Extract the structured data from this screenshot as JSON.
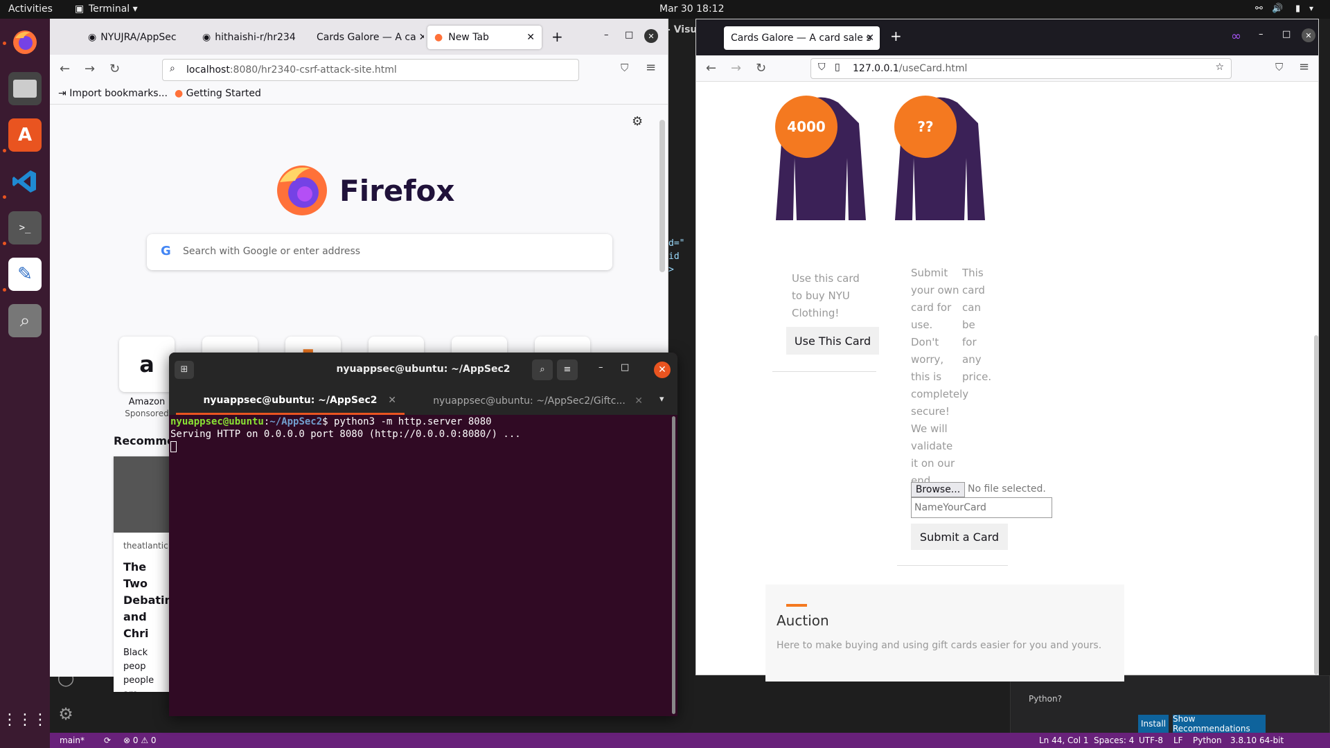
{
  "topbar": {
    "activities": "Activities",
    "app": "Terminal ▾",
    "datetime": "Mar 30  18:12"
  },
  "vscode": {
    "title_fragment": "- Visu",
    "code_fragments": [
      "d=\"",
      " id",
      ">"
    ],
    "status": {
      "branch": "main*",
      "errors": "⊗ 0 ⚠ 0",
      "position": "Ln 44, Col 1",
      "spaces": "Spaces: 4",
      "encoding": "UTF-8",
      "eol": "LF",
      "language": "Python",
      "version": "3.8.10 64-bit"
    },
    "notification": {
      "text": "Python?",
      "install": "Install",
      "recommend": "Show Recommendations"
    }
  },
  "ff_left": {
    "tabs": [
      "NYUJRA/AppSec",
      "hithaishi-r/hr234",
      "Cards Galore — A ca",
      "New Tab"
    ],
    "url_host": "localhost",
    "url_rest": ":8080/hr2340-csrf-attack-site.html",
    "bookmarks": [
      "Import bookmarks...",
      "Getting Started"
    ],
    "brand": "Firefox",
    "search_placeholder": "Search with Google or enter address",
    "tiles": [
      {
        "label": "Amazon",
        "sub": "Sponsored"
      }
    ],
    "recommended": "Recomme",
    "story": {
      "source": "theatlantic",
      "title": "The Two Debatin and Chri",
      "snippet": "Black peop people are discussing"
    }
  },
  "ff_right": {
    "tab": "Cards Galore — A card sale s",
    "url_host": "127.0.0.1",
    "url_rest": "/useCard.html",
    "cards": [
      {
        "badge": "4000"
      },
      {
        "badge": "??"
      }
    ],
    "card1_text": "Use this card to buy NYU Clothing!",
    "card1_button": "Use This Card",
    "card2_text": "Submit your own card for use. Don't worry, this is completely secure! We will validate it on our end.",
    "card2_text_b": "This card can be for any price.",
    "browse": "Browse...",
    "no_file": "No file selected.",
    "name_placeholder": "NameYourCard",
    "submit": "Submit a Card",
    "auction_title": "Auction",
    "auction_text": "Here to make buying and using gift cards easier for you and yours."
  },
  "terminal": {
    "title": "nyuappsec@ubuntu: ~/AppSec2",
    "tabs": [
      "nyuappsec@ubuntu: ~/AppSec2",
      "nyuappsec@ubuntu: ~/AppSec2/Giftc..."
    ],
    "prompt_user": "nyuappsec@ubuntu",
    "prompt_path": "~/AppSec2",
    "command": "$ python3 -m http.server 8080",
    "output": "Serving HTTP on 0.0.0.0 port 8080 (http://0.0.0.0:8080/) ..."
  },
  "colors": {
    "ubuntu_orange": "#e95420",
    "terminal_bg": "#300a24",
    "vscode_status": "#68217a",
    "badge": "#f47920",
    "hoodie": "#3b2157"
  }
}
